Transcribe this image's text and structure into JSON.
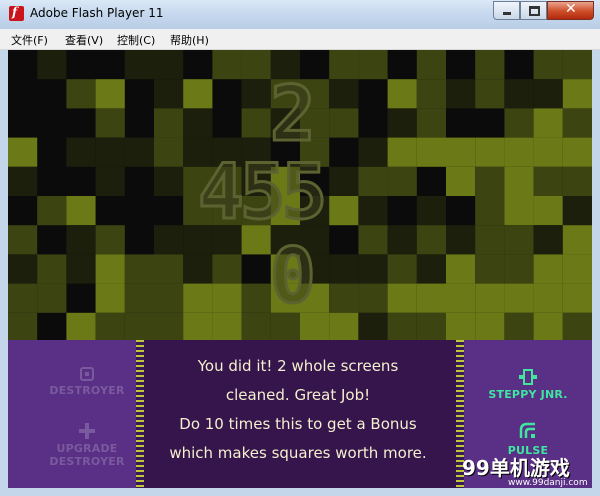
{
  "window": {
    "title": "Adobe Flash Player 11",
    "icon": "flash-icon",
    "close_glyph": "✕"
  },
  "menu": [
    {
      "label": "文件(F)"
    },
    {
      "label": "查看(V)"
    },
    {
      "label": "控制(C)"
    },
    {
      "label": "帮助(H)"
    }
  ],
  "game": {
    "digits": [
      "2",
      "455",
      "0"
    ],
    "message": [
      "You did it! 2 whole screens",
      "cleaned. Great Job!",
      "Do 10 times this to get a Bonus",
      "which makes squares worth more."
    ],
    "abilities_left": [
      {
        "label": "DESTROYER",
        "icon": "destroyer-icon",
        "active": false
      },
      {
        "label": "UPGRADE DESTROYER",
        "label_lines": [
          "UPGRADE",
          "DESTROYER"
        ],
        "icon": "upgrade-icon",
        "active": false
      }
    ],
    "abilities_right": [
      {
        "label": "STEPPY JNR.",
        "icon": "steppy-icon",
        "active": true
      },
      {
        "label": "PULSE",
        "icon": "pulse-icon",
        "active": true
      }
    ],
    "colors": {
      "tile_dark": "#0b0b0b",
      "tile_olive": "#3c4412",
      "tile_bright": "#6b7a16",
      "hud_purple": "#5a2f86",
      "hud_center": "#35154c",
      "active_green": "#3ee6a0"
    }
  },
  "watermark": {
    "brand": "99单机游戏",
    "url": "www.99danji.com"
  }
}
